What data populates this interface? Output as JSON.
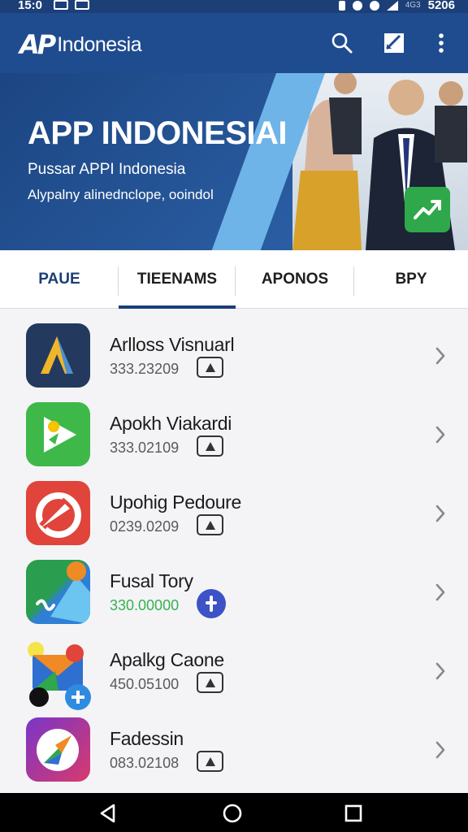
{
  "status_bar": {
    "time": "15:0",
    "battery": "5206",
    "network": "4G3"
  },
  "app_bar": {
    "logo_mark": "AP",
    "logo_name": "Indonesia",
    "icons": [
      "search-icon",
      "edit-icon",
      "more-vert-icon"
    ]
  },
  "banner": {
    "title": "APP INDONESIAI",
    "subtitle": "Pussar APPI Indonesia",
    "tagline": "Alypalny alinednclope, ooindol"
  },
  "tabs": [
    {
      "label": "PAUE"
    },
    {
      "label": "TIEENAMS",
      "selected": true
    },
    {
      "label": "APONOS"
    },
    {
      "label": "BPY"
    }
  ],
  "apps": [
    {
      "name": "Arlloss Visnuarl",
      "number": "333.23209",
      "badge": "pin-icon"
    },
    {
      "name": "Apokh Viakardi",
      "number": "333.02109",
      "badge": "pin-icon"
    },
    {
      "name": "Upohig Pedoure",
      "number": "0239.0209",
      "badge": "pin-icon"
    },
    {
      "name": "Fusal Tory",
      "number": "330.00000",
      "badge": "plus-icon",
      "number_color": "#34b24f"
    },
    {
      "name": "Apalkg Caone",
      "number": "450.05100",
      "badge": "pin-icon"
    },
    {
      "name": "Fadessin",
      "number": "083.02108",
      "badge": "pin-icon"
    }
  ],
  "colors": {
    "primary": "#1f4c8f",
    "accent_green": "#34b24f",
    "badge_blue": "#3d52c5"
  }
}
